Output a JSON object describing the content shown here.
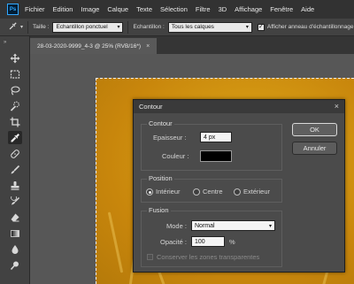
{
  "menubar": {
    "app_logo": "Ps",
    "items": [
      "Fichier",
      "Edition",
      "Image",
      "Calque",
      "Texte",
      "Sélection",
      "Filtre",
      "3D",
      "Affichage",
      "Fenêtre",
      "Aide"
    ]
  },
  "options": {
    "size_label": "Taille :",
    "size_value": "Echantillon ponctuel",
    "sample_label": "Echantillon :",
    "sample_value": "Tous les calques",
    "ring_checked": true,
    "ring_label": "Afficher anneau d'échantillonnage"
  },
  "toolbar": {
    "tools": [
      "move-tool",
      "marquee-tool",
      "lasso-tool",
      "quick-selection-tool",
      "crop-tool",
      "eyedropper-tool",
      "healing-brush-tool",
      "brush-tool",
      "clone-stamp-tool",
      "history-brush-tool",
      "eraser-tool",
      "gradient-tool",
      "blur-tool",
      "dodge-tool"
    ],
    "active_tool": "eyedropper-tool"
  },
  "document": {
    "tab_title": "28-03-2020-9999_4-3 @ 25% (RVB/16*)",
    "close_glyph": "×"
  },
  "dialog": {
    "title": "Contour",
    "close_glyph": "×",
    "contour": {
      "section_title": "Contour",
      "width_label": "Epaisseur :",
      "width_value": "4 px",
      "color_label": "Couleur :",
      "color_value": "#000000"
    },
    "position": {
      "section_title": "Position",
      "options": [
        "Intérieur",
        "Centre",
        "Extérieur"
      ],
      "selected": "Intérieur"
    },
    "fusion": {
      "section_title": "Fusion",
      "mode_label": "Mode :",
      "mode_value": "Normal",
      "opacity_label": "Opacité :",
      "opacity_value": "100",
      "opacity_unit": "%",
      "preserve_label": "Conserver les zones transparentes",
      "preserve_checked": false
    },
    "ok_label": "OK",
    "cancel_label": "Annuler"
  },
  "colors": {
    "accent_blue": "#31a8ff",
    "canvas_gold": "#d39712",
    "stroke_color": "#000000"
  }
}
